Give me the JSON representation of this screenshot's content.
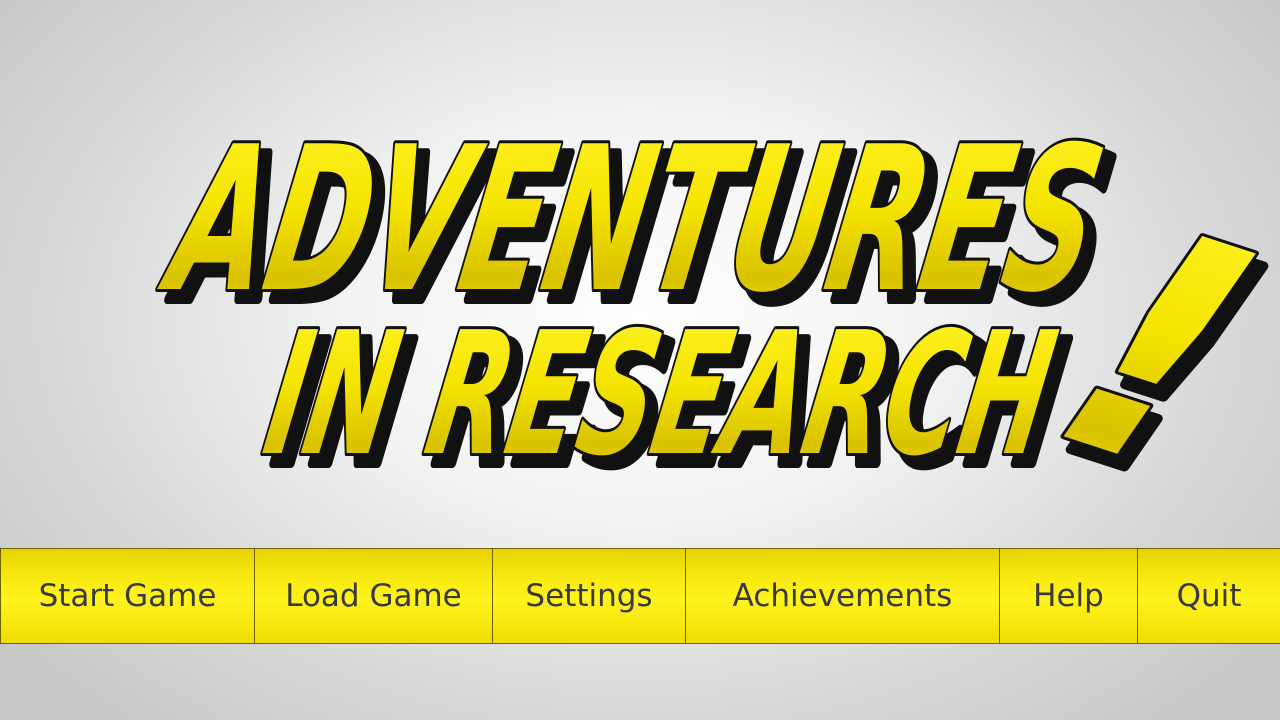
{
  "title": {
    "line1": "ADVENTURES",
    "line2": "IN RESEARCH",
    "exclamation": "!"
  },
  "menu": {
    "items": [
      {
        "label": "Start Game"
      },
      {
        "label": "Load Game"
      },
      {
        "label": "Settings"
      },
      {
        "label": "Achievements"
      },
      {
        "label": "Help"
      },
      {
        "label": "Quit"
      }
    ]
  },
  "colors": {
    "title_fill": "#f7e600",
    "title_shadow": "#111111",
    "button_fill": "#f4e300",
    "button_border": "#6b6200",
    "button_text": "#3a3a3a"
  }
}
